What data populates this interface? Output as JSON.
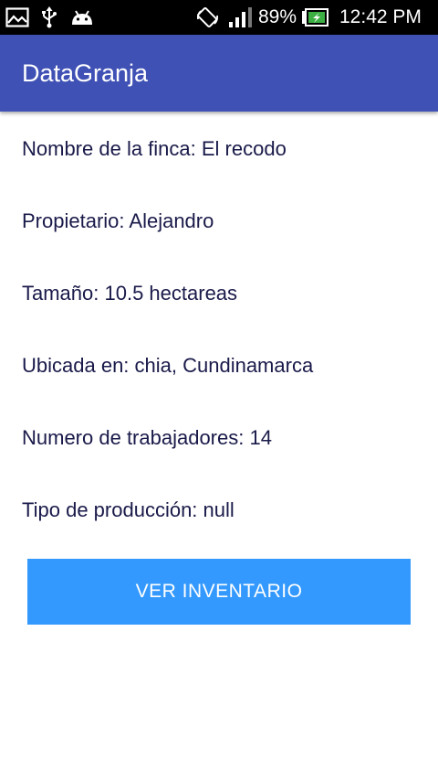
{
  "status_bar": {
    "battery_percent": "89%",
    "time": "12:42 PM",
    "icons": [
      "image-icon",
      "usb-icon",
      "android-icon",
      "screen-rotation-icon",
      "signal-icon",
      "battery-icon"
    ]
  },
  "app_bar": {
    "title": "DataGranja",
    "color": "#3f51b5"
  },
  "farm": {
    "name_line": "Nombre de la finca: El recodo",
    "owner_line": "Propietario: Alejandro",
    "size_line": "Tamaño: 10.5 hectareas",
    "location_line": "Ubicada en: chia, Cundinamarca",
    "workers_line": "Numero de trabajadores: 14",
    "production_line": "Tipo de producción: null"
  },
  "actions": {
    "inventory_button_label": "VER INVENTARIO",
    "button_color": "#3399ff"
  }
}
